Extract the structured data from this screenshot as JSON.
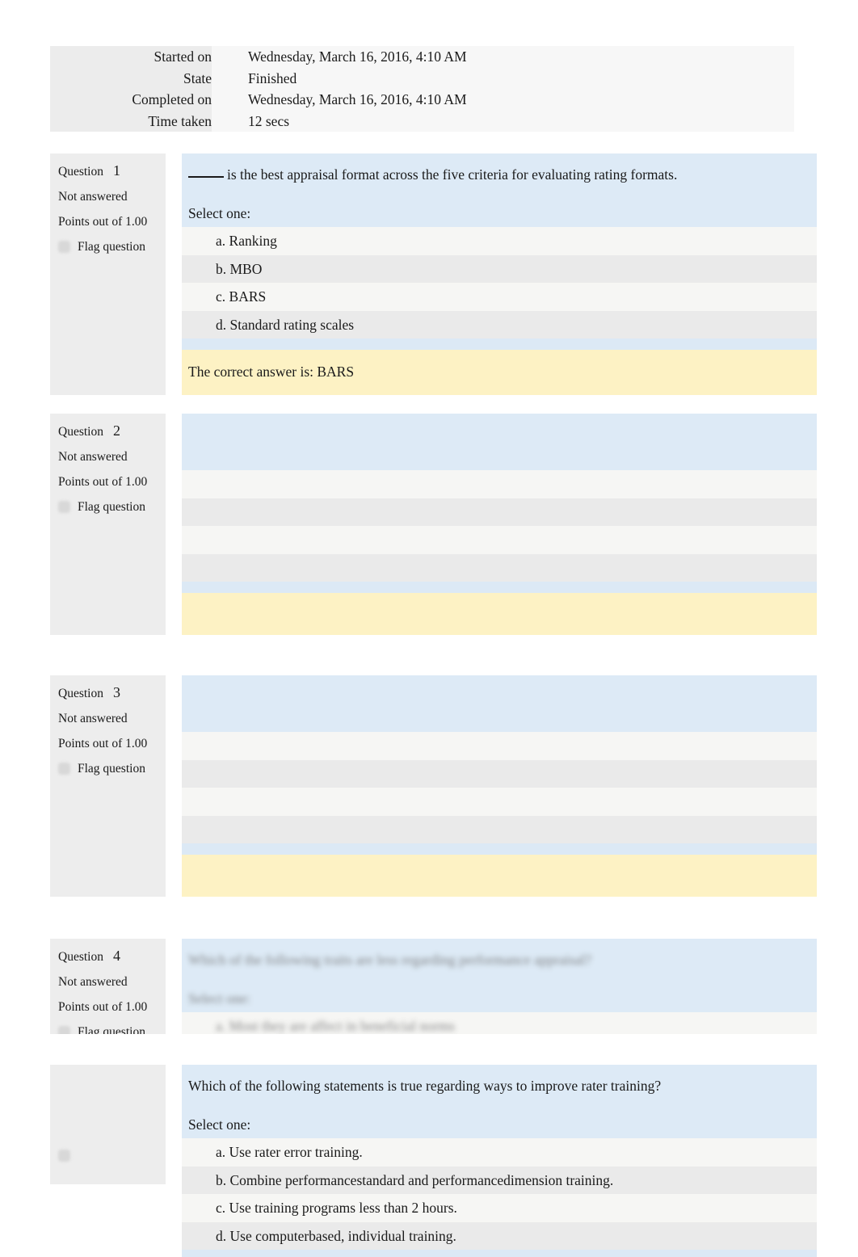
{
  "summary": {
    "rows": [
      {
        "label": "Started on",
        "value": "Wednesday, March 16, 2016, 4:10 AM"
      },
      {
        "label": "State",
        "value": "Finished"
      },
      {
        "label": "Completed on",
        "value": "Wednesday, March 16, 2016, 4:10 AM"
      },
      {
        "label": "Time taken",
        "value": "12 secs"
      }
    ]
  },
  "labels": {
    "question_word": "Question",
    "not_answered": "Not answered",
    "points": "Points out of 1.00",
    "flag": "Flag question",
    "select_one": "Select one:"
  },
  "colors": {
    "stem_blue": "#ddeaf6",
    "feedback_yellow": "#fdf2c4",
    "option_odd": "#f6f6f4",
    "option_even": "#eaeaea",
    "sidebar_gray": "#ededed",
    "summary_label_gray": "#ececec",
    "summary_value_gray": "#f7f7f7"
  },
  "questions": [
    {
      "number": "1",
      "status": "Not answered",
      "points": "Points out of 1.00",
      "flag": "Flag question",
      "stem": "is the best appraisal format across the five criteria for evaluating rating formats.",
      "stem_has_blank": true,
      "select_one": "Select one:",
      "options": [
        "a. Ranking",
        "b. MBO",
        "c. BARS",
        "d. Standard rating scales"
      ],
      "feedback": "The correct answer is: BARS",
      "legible": true
    },
    {
      "number": "2",
      "status": "Not answered",
      "points": "Points out of 1.00",
      "flag": "Flag question",
      "stem": "",
      "select_one": "",
      "options": [
        "",
        "",
        "",
        ""
      ],
      "feedback": "",
      "legible": false
    },
    {
      "number": "3",
      "status": "Not answered",
      "points": "Points out of 1.00",
      "flag": "Flag question",
      "stem": "",
      "select_one": "",
      "options": [
        "",
        "",
        "",
        ""
      ],
      "feedback": "",
      "legible": false
    },
    {
      "number": "4",
      "status": "Not answered",
      "points": "Points out of 1.00",
      "flag": "Flag question",
      "stem": "Which of the following traits are less regarding performance appraisal?",
      "select_one": "Select one:",
      "options": [
        "a. Most they are affect in beneficial norms"
      ],
      "feedback": "",
      "legible": false
    },
    {
      "number": "",
      "status": "",
      "points": "",
      "flag": "",
      "stem": "Which of the following statements is true regarding ways to improve rater training?",
      "select_one": "Select one:",
      "options": [
        "a. Use rater error training.",
        "b. Combine performancestandard and performancedimension training.",
        "c. Use training programs less than 2 hours.",
        "d. Use computerbased, individual training."
      ],
      "feedback": "",
      "legible": true
    }
  ]
}
